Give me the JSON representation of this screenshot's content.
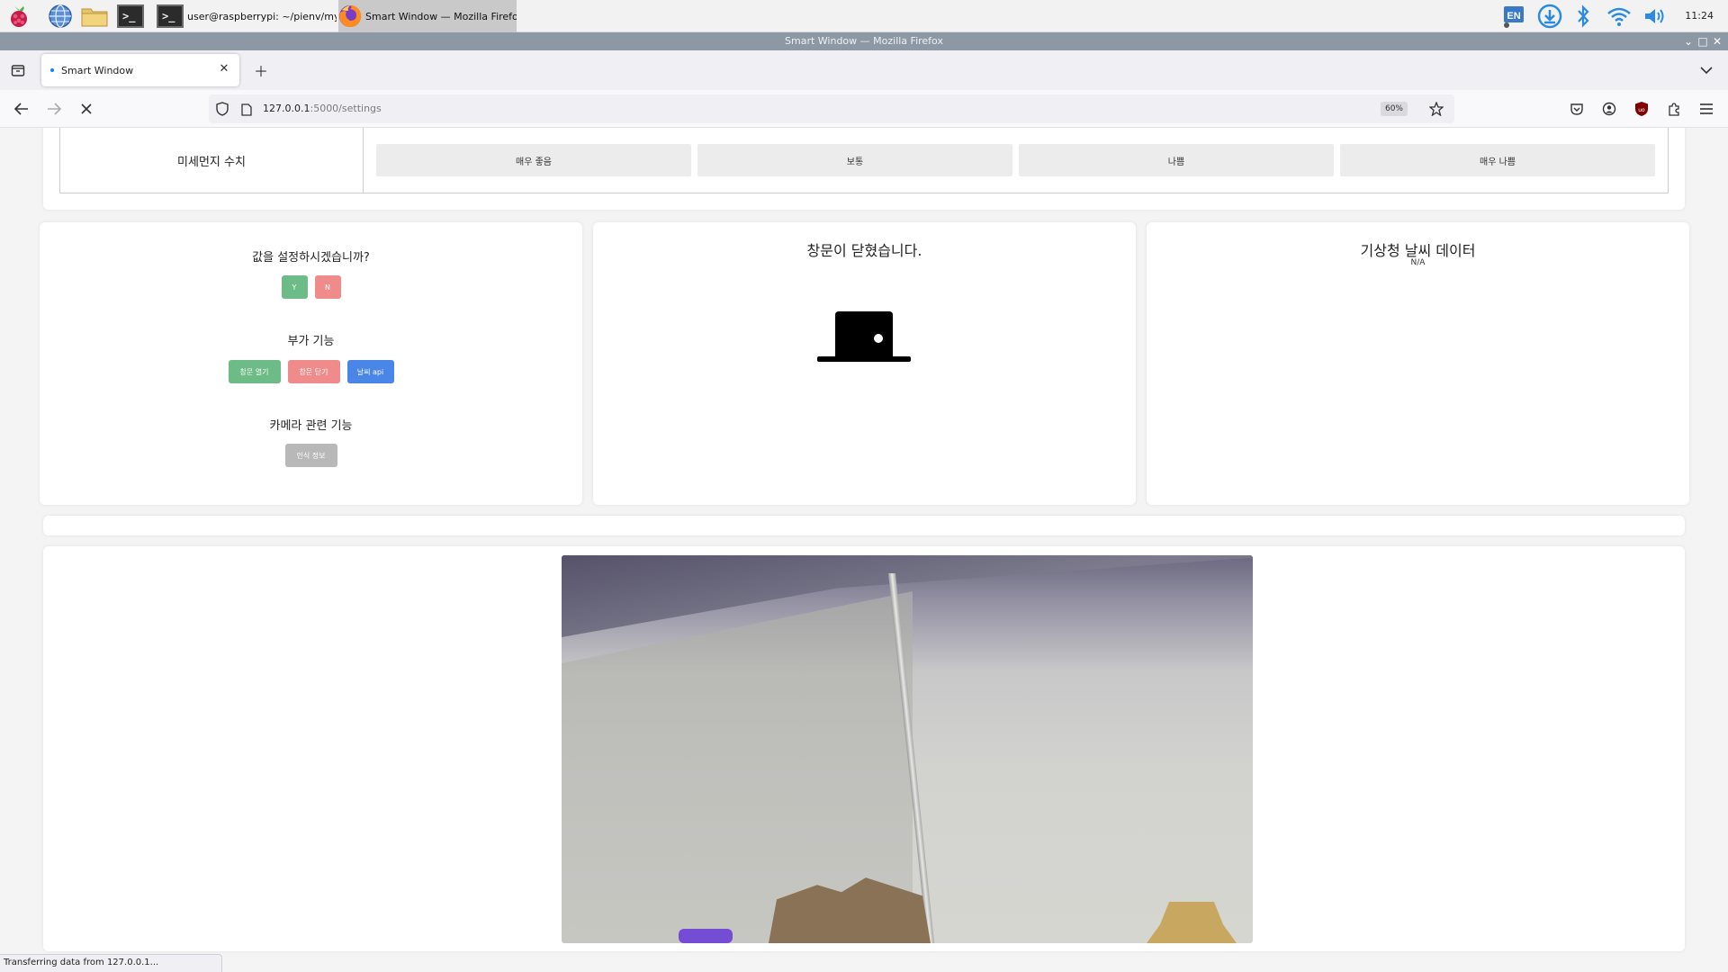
{
  "taskbar": {
    "tasks": [
      {
        "label": "user@raspberrypi: ~/pienv/myfla..."
      },
      {
        "label": "Smart Window — Mozilla Firefox"
      }
    ],
    "terminal_glyph": ">_",
    "lang": "EN",
    "clock": "11:24"
  },
  "window": {
    "title": "Smart Window — Mozilla Firefox"
  },
  "browser": {
    "tab_title": "Smart Window",
    "url_host": "127.0.0.1",
    "url_path": ":5000/settings",
    "zoom": "60%",
    "status": "Transferring data from 127.0.0.1..."
  },
  "pm": {
    "label": "미세먼지 수치",
    "levels": [
      "매우 좋음",
      "보통",
      "나쁨",
      "매우 나쁨"
    ]
  },
  "settings_card": {
    "question": "값을 설정하시겠습니까?",
    "yes": "Y",
    "no": "N",
    "extra_title": "부가 기능",
    "extra_buttons": [
      "창문 열기",
      "창문 닫기",
      "날씨 api"
    ],
    "camera_title": "카메라 관련 기능",
    "camera_button": "인식 정보"
  },
  "door_card": {
    "status": "창문이 닫혔습니다."
  },
  "weather_card": {
    "title": "기상청 날씨 데이터",
    "value": "N/A"
  },
  "colors": {
    "green": "#6dbb86",
    "red": "#f08b8b",
    "blue": "#4a86e8",
    "gray": "#b8b8b8"
  }
}
